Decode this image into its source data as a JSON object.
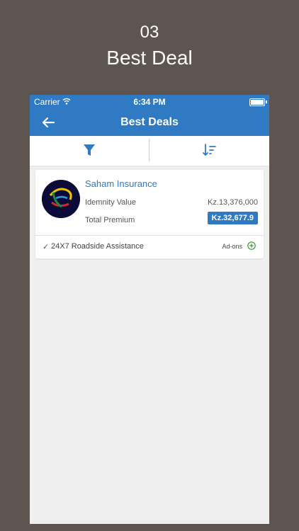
{
  "promo": {
    "step": "03",
    "title": "Best Deal"
  },
  "status_bar": {
    "carrier": "Carrier",
    "time": "6:34 PM"
  },
  "nav": {
    "title": "Best Deals"
  },
  "toolbar": {
    "filter_icon": "filter-icon",
    "sort_icon": "sort-icon"
  },
  "deal": {
    "insurer": "Saham Insurance",
    "idemnity_label": "Idemnity Value",
    "idemnity_value": "Kz.13,376,000",
    "premium_label": "Total Premium",
    "premium_value": "Kz.32,677.9",
    "check": "✓",
    "feature": "24X7 Roadside Assistance",
    "addons_label": "Ad-ons"
  },
  "colors": {
    "accent": "#2f7ac2",
    "backdrop": "#5e5550",
    "screen_bg": "#efefef",
    "addon_green": "#3a9a3a"
  }
}
